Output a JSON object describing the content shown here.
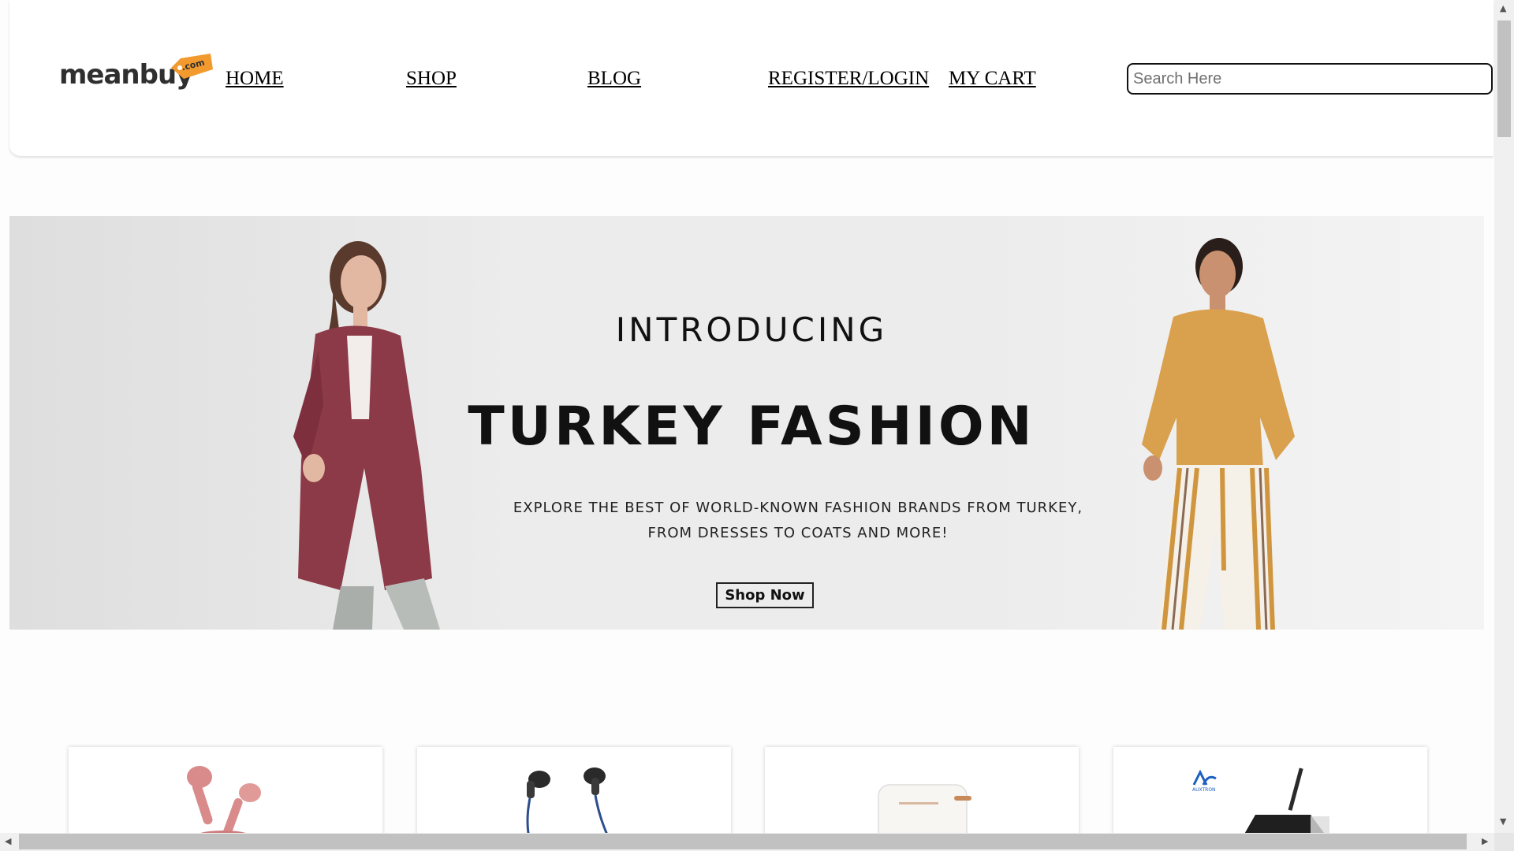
{
  "header": {
    "logo": {
      "word": "meanbuy",
      "tag": ".com"
    },
    "nav": [
      {
        "label": "HOME"
      },
      {
        "label": "SHOP"
      },
      {
        "label": "BLOG"
      },
      {
        "label": "REGISTER/LOGIN"
      },
      {
        "label": "MY CART"
      }
    ],
    "search": {
      "placeholder": "Search Here",
      "value": ""
    }
  },
  "hero": {
    "intro": "INTRODUCING",
    "title": "TURKEY FASHION",
    "subtitle_line1": "EXPLORE THE BEST OF WORLD-KNOWN FASHION BRANDS FROM TURKEY,",
    "subtitle_line2": "FROM DRESSES TO COATS AND MORE!",
    "button": "Shop Now"
  },
  "products": [
    {
      "icon": "pink-earbuds-image"
    },
    {
      "icon": "black-earphones-image"
    },
    {
      "icon": "white-mini-fridge-image"
    },
    {
      "icon": "auxtron-gadget-image",
      "brand": "AUXTRON"
    }
  ],
  "colors": {
    "logo_tag": "#f29a2e",
    "coat": "#8c3a48",
    "shirt": "#d9a04e",
    "earbuds": "#d98b8b"
  }
}
